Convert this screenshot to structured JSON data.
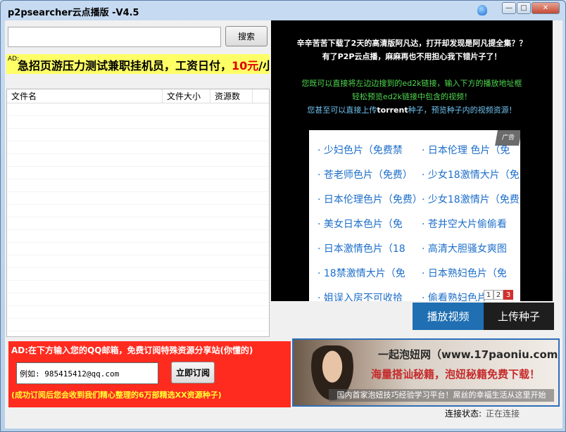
{
  "window": {
    "title": "p2psearcher云点播版 -V4.5",
    "buttons": {
      "minimize": "—",
      "maximize": "□",
      "close": "✕"
    }
  },
  "search": {
    "value": "",
    "placeholder": "",
    "button_label": "搜索"
  },
  "ad_strip": {
    "tag": "AD:",
    "text_before": "急招页游压力测试兼职挂机员，工资日付，",
    "price": "10元",
    "text_after": "/小时！"
  },
  "file_list": {
    "columns": [
      "文件名",
      "文件大小",
      "资源数"
    ],
    "rows": []
  },
  "video_panel": {
    "line1": "辛辛苦苦下载了2天的高清版阿凡达，打开却发现是阿凡提全集？？",
    "line2": "有了P2P云点播，麻麻再也不用担心我下错片子了！",
    "line3": "您既可以直接将左边边搜到的ed2k链接，输入下方的播放地址框",
    "line4": "轻松预览ed2k链接中包含的视频！",
    "line5_before": "您甚至可以直接上传",
    "line5_bold": "torrent",
    "line5_after": "种子，预览种子内的视频资源！",
    "ad_links": [
      "· 少妇色片（免费禁",
      "· 日本伦理 色片（免",
      "· 苍老师色片（免费）",
      "· 少女18激情大片（免",
      "· 日本伦理色片（免费）",
      "· 少女18激情片（免费）",
      "· 美女日本色片（免",
      "· 苍井空大片偷偷看",
      "· 日本激情色片（18",
      "· 高清大胆骚女爽图",
      "· 18禁激情大片（免",
      "· 日本熟妇色片（免",
      "· 姐误入房不可收拾",
      "· 偷看熟妇色片"
    ],
    "pager": [
      "1",
      "2",
      "3"
    ],
    "corner_label": "广告"
  },
  "actions": {
    "play_label": "播放视频",
    "upload_label": "上传种子"
  },
  "subscribe": {
    "title": "AD:在下方输入您的QQ邮箱，免费订阅特殊资源分享站(你懂的)",
    "email_value": "例如: 985415412@qq.com",
    "button_label": "立即订阅",
    "note": "(成功订阅后您会收到我们精心整理的6万部精选XX资源种子)"
  },
  "banner": {
    "line1": "一起泡妞网（www.17paoniu.com）",
    "line2": "海量搭讪秘籍，泡妞秘籍免费下载！",
    "line3": "国内首家泡妞技巧经验学习平台！屌丝的幸福生活从这里开始"
  },
  "status": {
    "label": "连接状态:",
    "value": "正在连接"
  }
}
